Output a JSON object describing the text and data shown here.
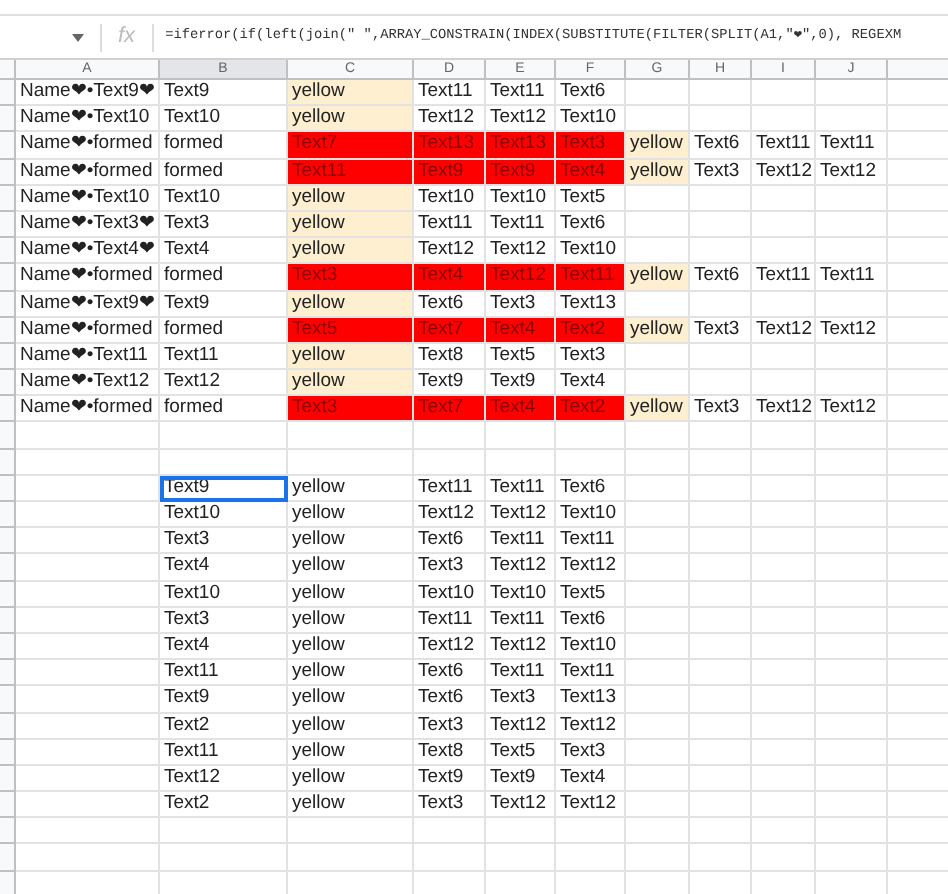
{
  "formula_bar": {
    "function_label": "fx",
    "formula": "=iferror(if(left(join(\" \",ARRAY_CONSTRAIN(INDEX(SUBSTITUTE(FILTER(SPLIT(A1,\"❤\",0), REGEXM"
  },
  "columns": [
    {
      "label": "A",
      "selected": false
    },
    {
      "label": "B",
      "selected": true
    },
    {
      "label": "C",
      "selected": false
    },
    {
      "label": "D",
      "selected": false
    },
    {
      "label": "E",
      "selected": false
    },
    {
      "label": "F",
      "selected": false
    },
    {
      "label": "G",
      "selected": false
    },
    {
      "label": "H",
      "selected": false
    },
    {
      "label": "I",
      "selected": false
    },
    {
      "label": "J",
      "selected": false
    }
  ],
  "block_1": [
    {
      "kind": "plain",
      "cells": [
        "Name❤•Text9❤",
        "Text9",
        "yellow",
        "Text11",
        "Text11",
        "Text6"
      ]
    },
    {
      "kind": "plain",
      "cells": [
        "Name❤•Text10",
        "Text10",
        "yellow",
        "Text12",
        "Text12",
        "Text10"
      ]
    },
    {
      "kind": "match",
      "cells": [
        "Name❤•formed",
        "formed",
        "Text7",
        "Text13",
        "Text13",
        "Text3",
        "yellow",
        "Text6",
        "Text11",
        "Text11"
      ]
    },
    {
      "kind": "match",
      "cells": [
        "Name❤•formed",
        "formed",
        "Text11",
        "Text9",
        "Text9",
        "Text4",
        "yellow",
        "Text3",
        "Text12",
        "Text12"
      ]
    },
    {
      "kind": "plain",
      "cells": [
        "Name❤•Text10",
        "Text10",
        "yellow",
        "Text10",
        "Text10",
        "Text5"
      ]
    },
    {
      "kind": "plain",
      "cells": [
        "Name❤•Text3❤",
        "Text3",
        "yellow",
        "Text11",
        "Text11",
        "Text6"
      ]
    },
    {
      "kind": "plain",
      "cells": [
        "Name❤•Text4❤",
        "Text4",
        "yellow",
        "Text12",
        "Text12",
        "Text10"
      ]
    },
    {
      "kind": "match",
      "cells": [
        "Name❤•formed",
        "formed",
        "Text3",
        "Text4",
        "Text12",
        "Text11",
        "yellow",
        "Text6",
        "Text11",
        "Text11"
      ]
    },
    {
      "kind": "plain",
      "cells": [
        "Name❤•Text9❤",
        "Text9",
        "yellow",
        "Text6",
        "Text3",
        "Text13"
      ]
    },
    {
      "kind": "match",
      "cells": [
        "Name❤•formed",
        "formed",
        "Text5",
        "Text7",
        "Text4",
        "Text2",
        "yellow",
        "Text3",
        "Text12",
        "Text12"
      ]
    },
    {
      "kind": "plain",
      "cells": [
        "Name❤•Text11",
        "Text11",
        "yellow",
        "Text8",
        "Text5",
        "Text3"
      ]
    },
    {
      "kind": "plain",
      "cells": [
        "Name❤•Text12",
        "Text12",
        "yellow",
        "Text9",
        "Text9",
        "Text4"
      ]
    },
    {
      "kind": "match",
      "cells": [
        "Name❤•formed",
        "formed",
        "Text3",
        "Text7",
        "Text4",
        "Text2",
        "yellow",
        "Text3",
        "Text12",
        "Text12"
      ]
    }
  ],
  "block_2": [
    {
      "selected": true,
      "cells": [
        "Text9",
        "yellow",
        "Text11",
        "Text11",
        "Text6"
      ]
    },
    {
      "selected": false,
      "cells": [
        "Text10",
        "yellow",
        "Text12",
        "Text12",
        "Text10"
      ]
    },
    {
      "selected": false,
      "cells": [
        "Text3",
        "yellow",
        "Text6",
        "Text11",
        "Text11"
      ]
    },
    {
      "selected": false,
      "cells": [
        "Text4",
        "yellow",
        "Text3",
        "Text12",
        "Text12"
      ]
    },
    {
      "selected": false,
      "cells": [
        "Text10",
        "yellow",
        "Text10",
        "Text10",
        "Text5"
      ]
    },
    {
      "selected": false,
      "cells": [
        "Text3",
        "yellow",
        "Text11",
        "Text11",
        "Text6"
      ]
    },
    {
      "selected": false,
      "cells": [
        "Text4",
        "yellow",
        "Text12",
        "Text12",
        "Text10"
      ]
    },
    {
      "selected": false,
      "cells": [
        "Text11",
        "yellow",
        "Text6",
        "Text11",
        "Text11"
      ]
    },
    {
      "selected": false,
      "cells": [
        "Text9",
        "yellow",
        "Text6",
        "Text3",
        "Text13"
      ]
    },
    {
      "selected": false,
      "cells": [
        "Text2",
        "yellow",
        "Text3",
        "Text12",
        "Text12"
      ]
    },
    {
      "selected": false,
      "cells": [
        "Text11",
        "yellow",
        "Text8",
        "Text5",
        "Text3"
      ]
    },
    {
      "selected": false,
      "cells": [
        "Text12",
        "yellow",
        "Text9",
        "Text9",
        "Text4"
      ]
    },
    {
      "selected": false,
      "cells": [
        "Text2",
        "yellow",
        "Text3",
        "Text12",
        "Text12"
      ]
    }
  ]
}
